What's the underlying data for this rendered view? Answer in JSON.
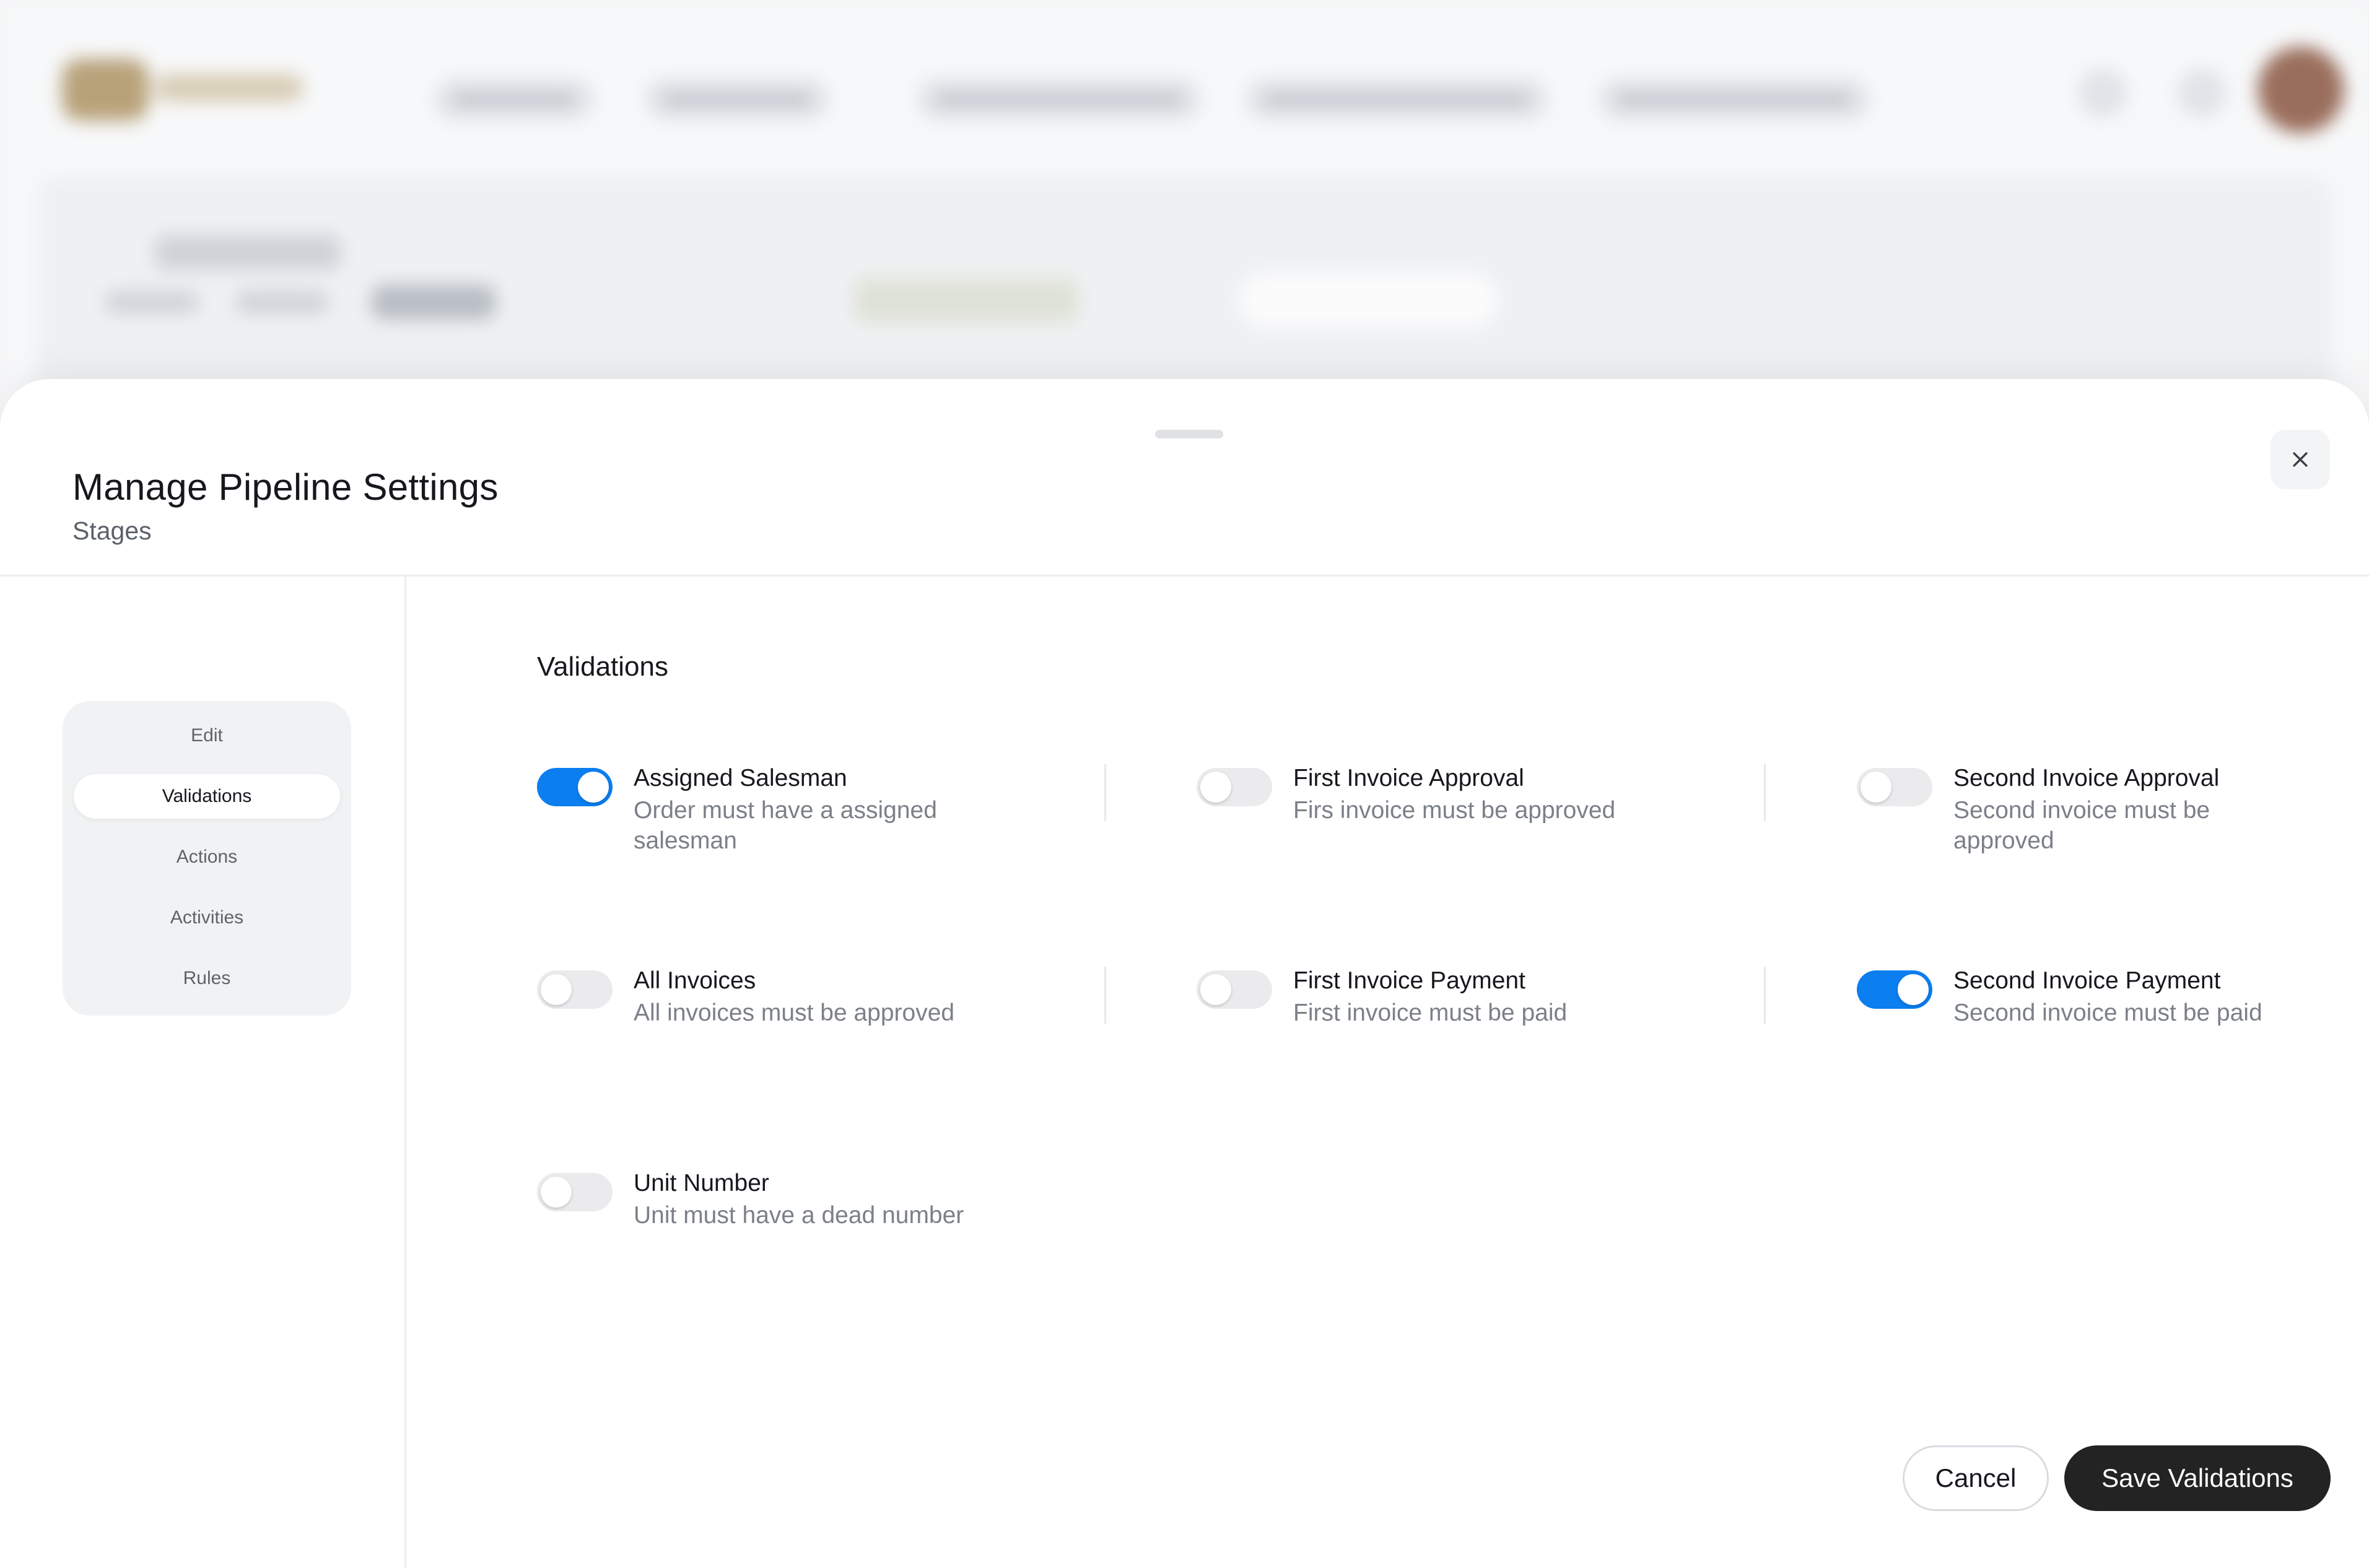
{
  "modal": {
    "title": "Manage Pipeline Settings",
    "subtitle": "Stages",
    "close_icon": "close-icon"
  },
  "nav": {
    "items": [
      {
        "label": "Edit",
        "active": false
      },
      {
        "label": "Validations",
        "active": true
      },
      {
        "label": "Actions",
        "active": false
      },
      {
        "label": "Activities",
        "active": false
      },
      {
        "label": "Rules",
        "active": false
      }
    ]
  },
  "validations": {
    "title": "Validations",
    "items": [
      {
        "label": "Assigned Salesman",
        "description": "Order must have a assigned salesman",
        "enabled": true
      },
      {
        "label": "First Invoice Approval",
        "description": "Firs invoice must be approved",
        "enabled": false
      },
      {
        "label": "Second Invoice Approval",
        "description": "Second invoice must be approved",
        "enabled": false
      },
      {
        "label": "All Invoices",
        "description": "All invoices must be approved",
        "enabled": false
      },
      {
        "label": "First Invoice Payment",
        "description": "First invoice must be paid",
        "enabled": false
      },
      {
        "label": "Second Invoice Payment",
        "description": "Second invoice must be paid",
        "enabled": true
      },
      {
        "label": "Unit Number",
        "description": "Unit must have a dead number",
        "enabled": false
      }
    ]
  },
  "footer": {
    "cancel_label": "Cancel",
    "save_label": "Save Validations"
  },
  "colors": {
    "toggle_on": "#0b7ef0",
    "toggle_off": "#ebebed",
    "primary_button": "#232323"
  }
}
